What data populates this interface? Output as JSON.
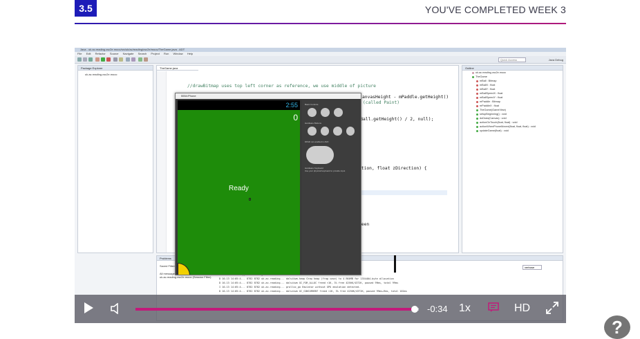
{
  "header": {
    "step_number": "3.5",
    "title": "YOU'VE COMPLETED WEEK 3"
  },
  "ide": {
    "window_title": "Java - uk.ac.reading.csc2e.mooc/src/uk/ac/reading/csc2e/mooc/TheGame.java - ADT",
    "menu": [
      "File",
      "Edit",
      "Refactor",
      "Source",
      "Navigate",
      "Search",
      "Project",
      "Run",
      "Window",
      "Help"
    ],
    "quick_access": "Quick Access",
    "perspectives": "Java  Debug",
    "package_explorer": {
      "tab": "Package Explorer",
      "items": [
        "uk.ac.reading.csc2e.mooc"
      ]
    },
    "editor": {
      "tab": "TheGame.java",
      "code_lines": [
        {
          "kind": "comment",
          "text": "//drawBitmap uses top left corner as reference, we use middle of picture"
        },
        {
          "kind": "comment",
          "text": "//null means that we will use the image without any extra features (called Paint)"
        },
        {
          "kind": "text",
          "text": "canvas.drawBitmap(mBall, mBallX - mBall.getWidth() / 2, mBallY - mBall.getHeight() / 2, null);"
        }
      ],
      "fragment_paddle": "anvasHeight - mPaddle.getHeight()",
      "fragment_params": "ction, float zDirection) {",
      "fragment_green": "reen"
    },
    "outline": {
      "tab": "Outline",
      "items": [
        "uk.ac.reading.csc2e.mooc",
        "TheGame",
        "mBall : Bitmap",
        "mBallX : float",
        "mBallY : float",
        "mBallSpeedX : float",
        "mBallSpeedY : float",
        "mPaddle : Bitmap",
        "mPaddleX : float",
        "TheGame(GameView)",
        "setupBeginning() : void",
        "doDraw(Canvas) : void",
        "actionOnTouch(float, float) : void",
        "actionWhenPhoneMoved(float, float, float) : void",
        "updateGame(float) : void"
      ]
    },
    "problems": {
      "tab": "Problems",
      "saved_filters": "Saved Filters",
      "filters": [
        "All messages",
        "uk.ac.reading.csc2e.mooc (Session Filter)"
      ],
      "verbose": "verbose",
      "log_header": "L   Time          PID   TID   Application          Tag              Text",
      "log_lines": [
        "D   10-13 14:05:4...   8782  8782  uk.ac.reading...   dalvikvm-heap   Grow heap (frag case) to 4.904MB for 1354404-byte allocation",
        "D   10-13 14:05:4...   8782  8782  uk.ac.reading...   dalvikvm        GC_FOR_ALLOC freed <1K, 3% free 4256K/4372K, paused 99ms, total 99ms",
        "I   10-13 14:05:4...   8782  8782  uk.ac.reading...   gralloc_go     Emulator without GPU emulation detected.",
        "D   10-13 14:05:4...   8782  8782  uk.ac.reading...   dalvikvm        GC_CONCURRENT freed <1K, 3% free 4256K/4372K, paused 99ms+9ms, total 102ms"
      ]
    }
  },
  "emulator": {
    "title": "5554:Phone",
    "clock": "2:55",
    "score": "0",
    "ready_text": "Ready",
    "basic_controls": "Basic Controls",
    "hardware_buttons": "Hardware Buttons",
    "dpad_label": "DPAD not enabled in AVD",
    "keyboard_label": "Hardware Keyboard",
    "keyboard_hint": "Use your physical keyboard to provide input"
  },
  "player": {
    "progress": 0.985,
    "time_remaining": "-0:34",
    "speed": "1x",
    "quality": "HD",
    "accent_color": "#c2197a"
  },
  "help": {
    "label": "?"
  }
}
